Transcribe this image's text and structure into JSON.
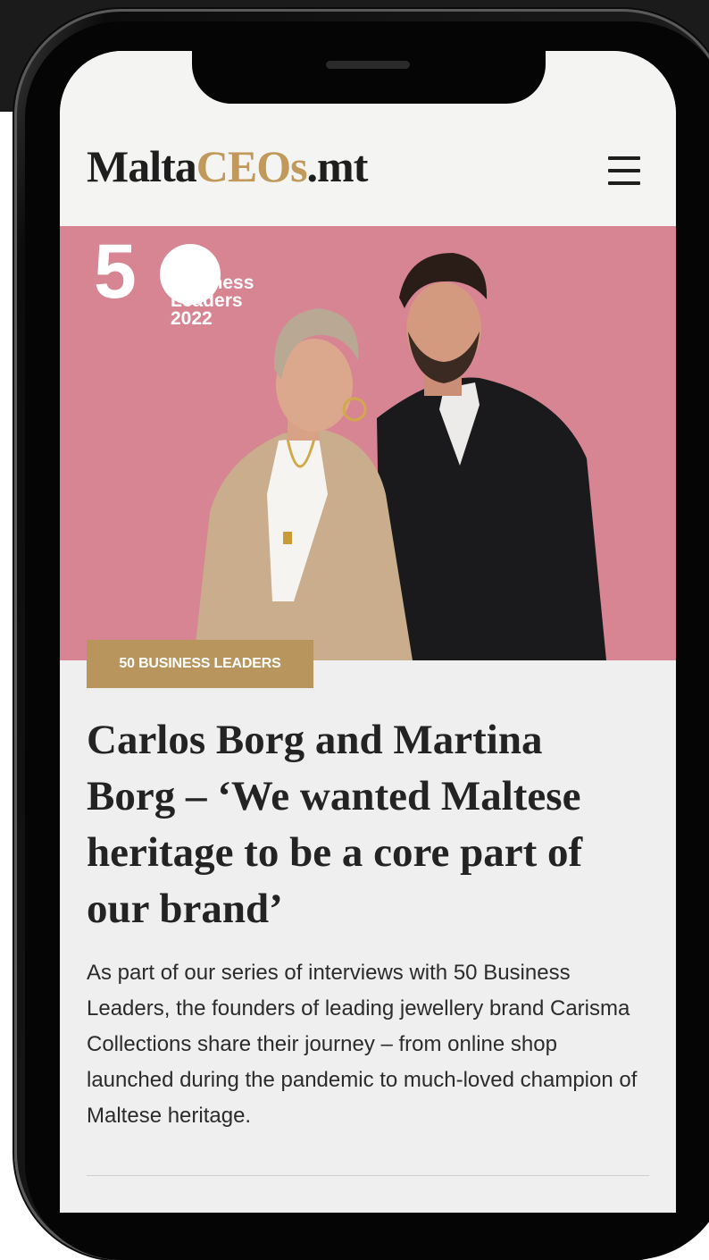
{
  "site": {
    "logo_part1": "Malta",
    "logo_part2": "CEOs",
    "logo_part3": ".mt",
    "menu_icon": "hamburger-menu-icon"
  },
  "hero": {
    "badge_number": "5",
    "badge_line1": "Business",
    "badge_line2": "Leaders",
    "badge_line3": "2022",
    "background_color": "#d78593"
  },
  "article": {
    "category": "50 BUSINESS LEADERS",
    "headline": "Carlos Borg and Martina Borg – ‘We wanted Maltese heritage to be a core part of our brand’",
    "summary": "As part of our series of interviews with 50 Business Leaders, the founders of leading jewellery brand Carisma Collections share their journey – from online shop launched during the pandemic to much-loved champion of Maltese heritage."
  },
  "colors": {
    "accent_gold": "#c0995b",
    "badge_gold": "#b8955c",
    "text_dark": "#1e1e1e"
  }
}
